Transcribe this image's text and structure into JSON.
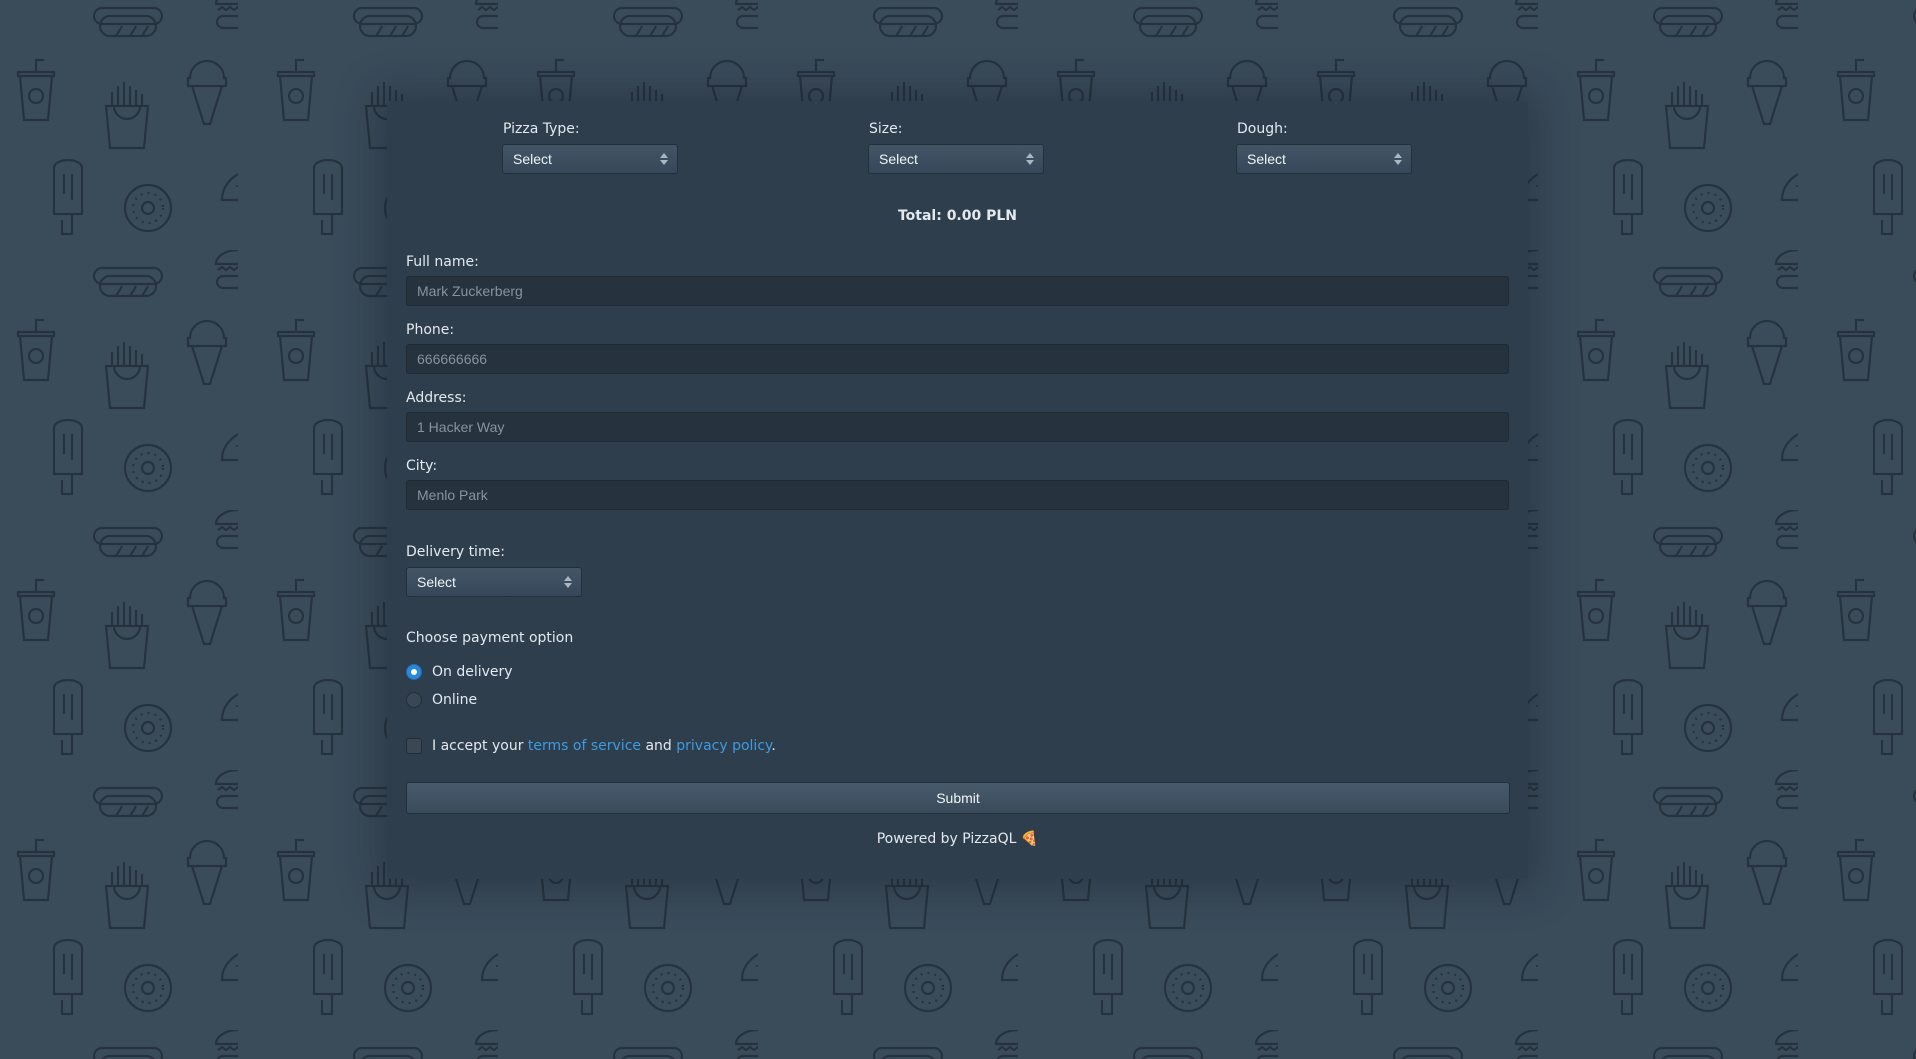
{
  "order": {
    "pizza_type": {
      "label": "Pizza Type:",
      "value": "Select"
    },
    "size": {
      "label": "Size:",
      "value": "Select"
    },
    "dough": {
      "label": "Dough:",
      "value": "Select"
    },
    "total": "Total: 0.00 PLN"
  },
  "form": {
    "full_name": {
      "label": "Full name:",
      "placeholder": "Mark Zuckerberg"
    },
    "phone": {
      "label": "Phone:",
      "placeholder": "666666666"
    },
    "address": {
      "label": "Address:",
      "placeholder": "1 Hacker Way"
    },
    "city": {
      "label": "City:",
      "placeholder": "Menlo Park"
    },
    "delivery_time": {
      "label": "Delivery time:",
      "value": "Select"
    }
  },
  "payment": {
    "title": "Choose payment option",
    "options": [
      {
        "label": "On delivery",
        "selected": true
      },
      {
        "label": "Online",
        "selected": false
      }
    ]
  },
  "terms": {
    "prefix": "I accept your ",
    "tos_link": "terms of service",
    "middle": " and ",
    "privacy_link": "privacy policy",
    "suffix": ".",
    "checked": false
  },
  "submit_label": "Submit",
  "footer": {
    "text": "Powered by PizzaQL",
    "icon": "🍕"
  },
  "colors": {
    "background": "#3a4b5a",
    "card": "#2f3e4c",
    "accent": "#2b88d8",
    "link": "#3d9be0"
  }
}
